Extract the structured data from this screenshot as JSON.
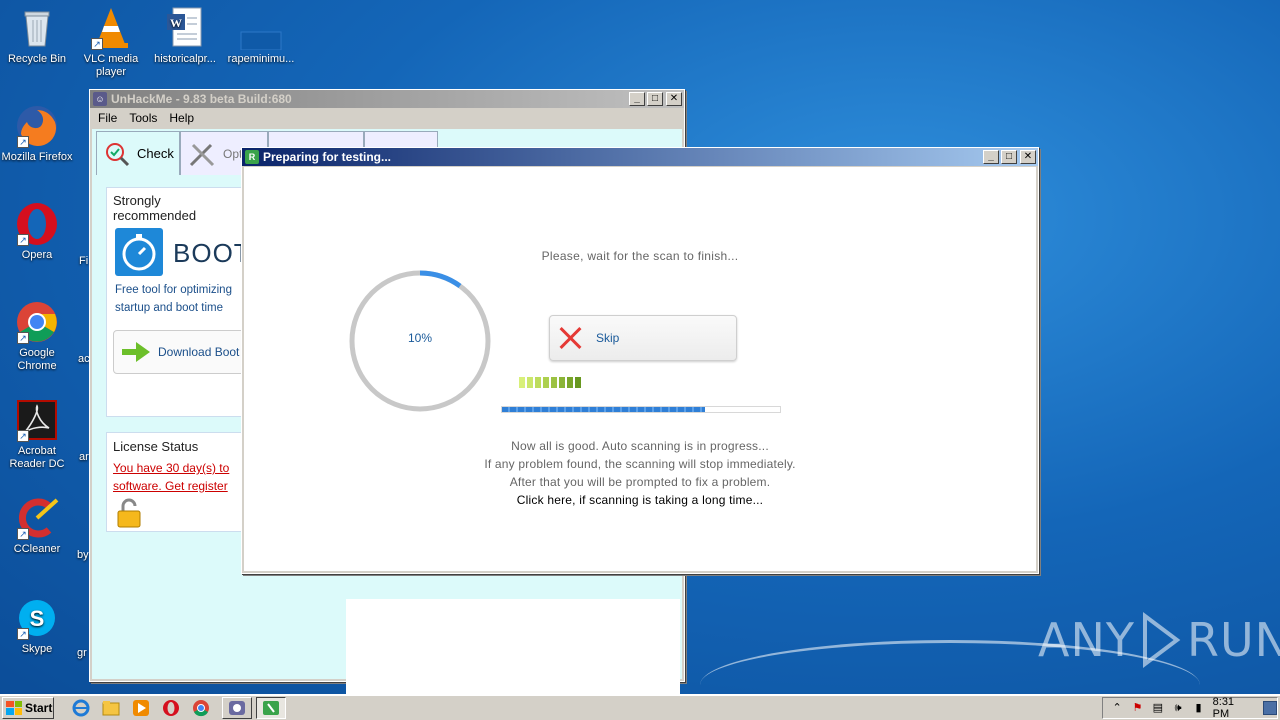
{
  "desktop": {
    "icons": [
      {
        "label": "Recycle Bin"
      },
      {
        "label": "VLC media player"
      },
      {
        "label": "historicalpr..."
      },
      {
        "label": "rapeminimu..."
      },
      {
        "label": "Mozilla Firefox"
      },
      {
        "label": "Opera"
      },
      {
        "label": "Google Chrome"
      },
      {
        "label": "Acrobat Reader DC"
      },
      {
        "label": "CCleaner"
      },
      {
        "label": "Skype"
      }
    ],
    "partial_labels": [
      "Fi",
      "ac",
      "ar",
      "by",
      "gr"
    ]
  },
  "unhackme": {
    "title": "UnHackMe - 9.83 beta Build:680",
    "menu": [
      "File",
      "Tools",
      "Help"
    ],
    "tabs": [
      "Check",
      "Opt"
    ],
    "recommended_heading": "Strongly recommended",
    "boot_title": "BOOT",
    "boot_desc_1": "Free tool for optimizing",
    "boot_desc_2": "startup and boot time",
    "download_label": "Download Boot",
    "license_heading": "License Status",
    "license_line_1": "You have 30 day(s) to",
    "license_line_2": "software. Get register"
  },
  "dialog": {
    "title": "Preparing for testing...",
    "wait_text": "Please, wait for the scan to finish...",
    "percent_label": "10%",
    "percent_value": 0.1,
    "skip_label": "Skip",
    "progress_value": 0.73,
    "messages": [
      "Now all is good. Auto scanning is in progress...",
      "If any problem found, the scanning will stop immediately.",
      "After that you will be prompted to fix a problem."
    ],
    "long_time_link": "Click here, if scanning is taking a long time..."
  },
  "taskbar": {
    "start_label": "Start",
    "clock": "8:31 PM"
  },
  "watermark": "ANY RUN",
  "colors": {
    "accent": "#3a8fe6",
    "ring_track": "#c8c8c8",
    "skip_x": "#e53935",
    "license_red": "#cc0000"
  }
}
